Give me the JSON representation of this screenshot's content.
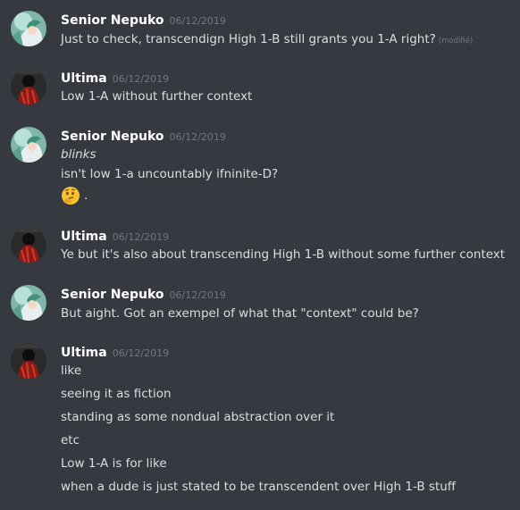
{
  "messages": [
    {
      "author": "Senior Nepuko",
      "timestamp": "06/12/2019",
      "lines": [
        "Just to check, transcendign High 1-B still grants you 1-A right?"
      ],
      "edited_label": "(modifié)"
    },
    {
      "author": "Ultima",
      "timestamp": "06/12/2019",
      "lines": [
        "Low 1-A without further context"
      ]
    },
    {
      "author": "Senior Nepuko",
      "timestamp": "06/12/2019",
      "lines": [
        "blinks",
        "isn't low 1-a uncountably ifninite-D?"
      ],
      "emoji_name": "thinking-face-emoji",
      "emoji_suffix": "."
    },
    {
      "author": "Ultima",
      "timestamp": "06/12/2019",
      "lines": [
        "Ye but it's also about transcending High 1-B without some further context"
      ]
    },
    {
      "author": "Senior Nepuko",
      "timestamp": "06/12/2019",
      "lines": [
        "But aight. Got an exempel of what that \"context\" could be?"
      ]
    },
    {
      "author": "Ultima",
      "timestamp": "06/12/2019",
      "lines": [
        "like",
        "seeing it as fiction",
        "standing as some nondual abstraction over it",
        "etc",
        "Low 1-A is for like",
        "when a dude is just stated to be transcendent over High 1-B stuff"
      ]
    }
  ],
  "colors": {
    "background": "#36393f",
    "username": "#ffffff",
    "timestamp": "#72767d",
    "message_text": "#dcddde"
  }
}
